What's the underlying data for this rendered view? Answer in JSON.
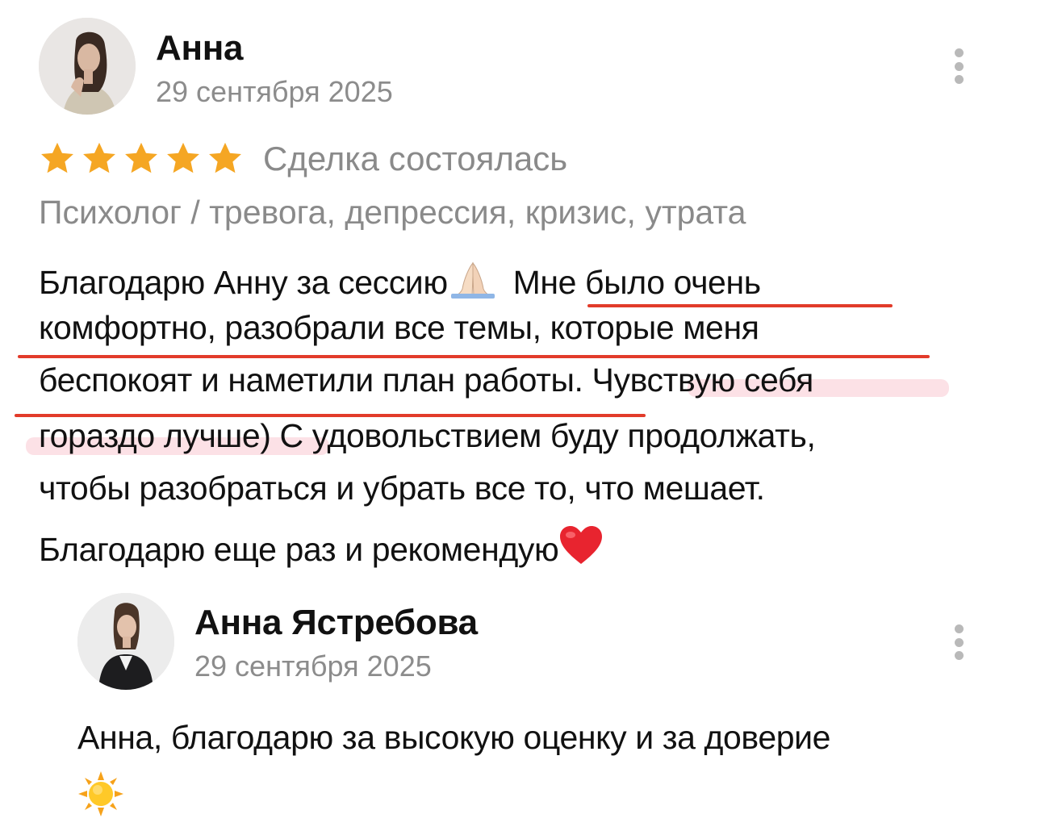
{
  "review": {
    "author": "Анна",
    "date": "29 сентября 2025",
    "rating": 5,
    "rating_max": 5,
    "deal_status": "Сделка состоялась",
    "category": "Психолог / тревога, депрессия, кризис, утрата",
    "text_lines": [
      "Благодарю Анну за сессию",
      "Мне было очень",
      "комфортно, разобрали все темы, которые меня",
      "беспокоят и наметили план работы. Чувствую себя",
      "гораздо лучше) С удовольствием буду продолжать,",
      "чтобы разобраться и убрать все то, что мешает.",
      "Благодарю еще раз и рекомендую"
    ],
    "icons": [
      "avatar",
      "star-icon",
      "pray-emoji-icon",
      "heart-emoji-icon",
      "more-options-icon"
    ]
  },
  "reply": {
    "author": "Анна Ястребова",
    "date": "29 сентября 2025",
    "text": "Анна, благодарю за высокую оценку и за доверие",
    "icons": [
      "avatar",
      "sun-emoji-icon",
      "more-options-icon"
    ]
  },
  "colors": {
    "star": "#F5A623",
    "annotation_underline": "#E23B2A",
    "annotation_highlight": "#F0788C",
    "secondary_text": "#8A8A8A"
  }
}
